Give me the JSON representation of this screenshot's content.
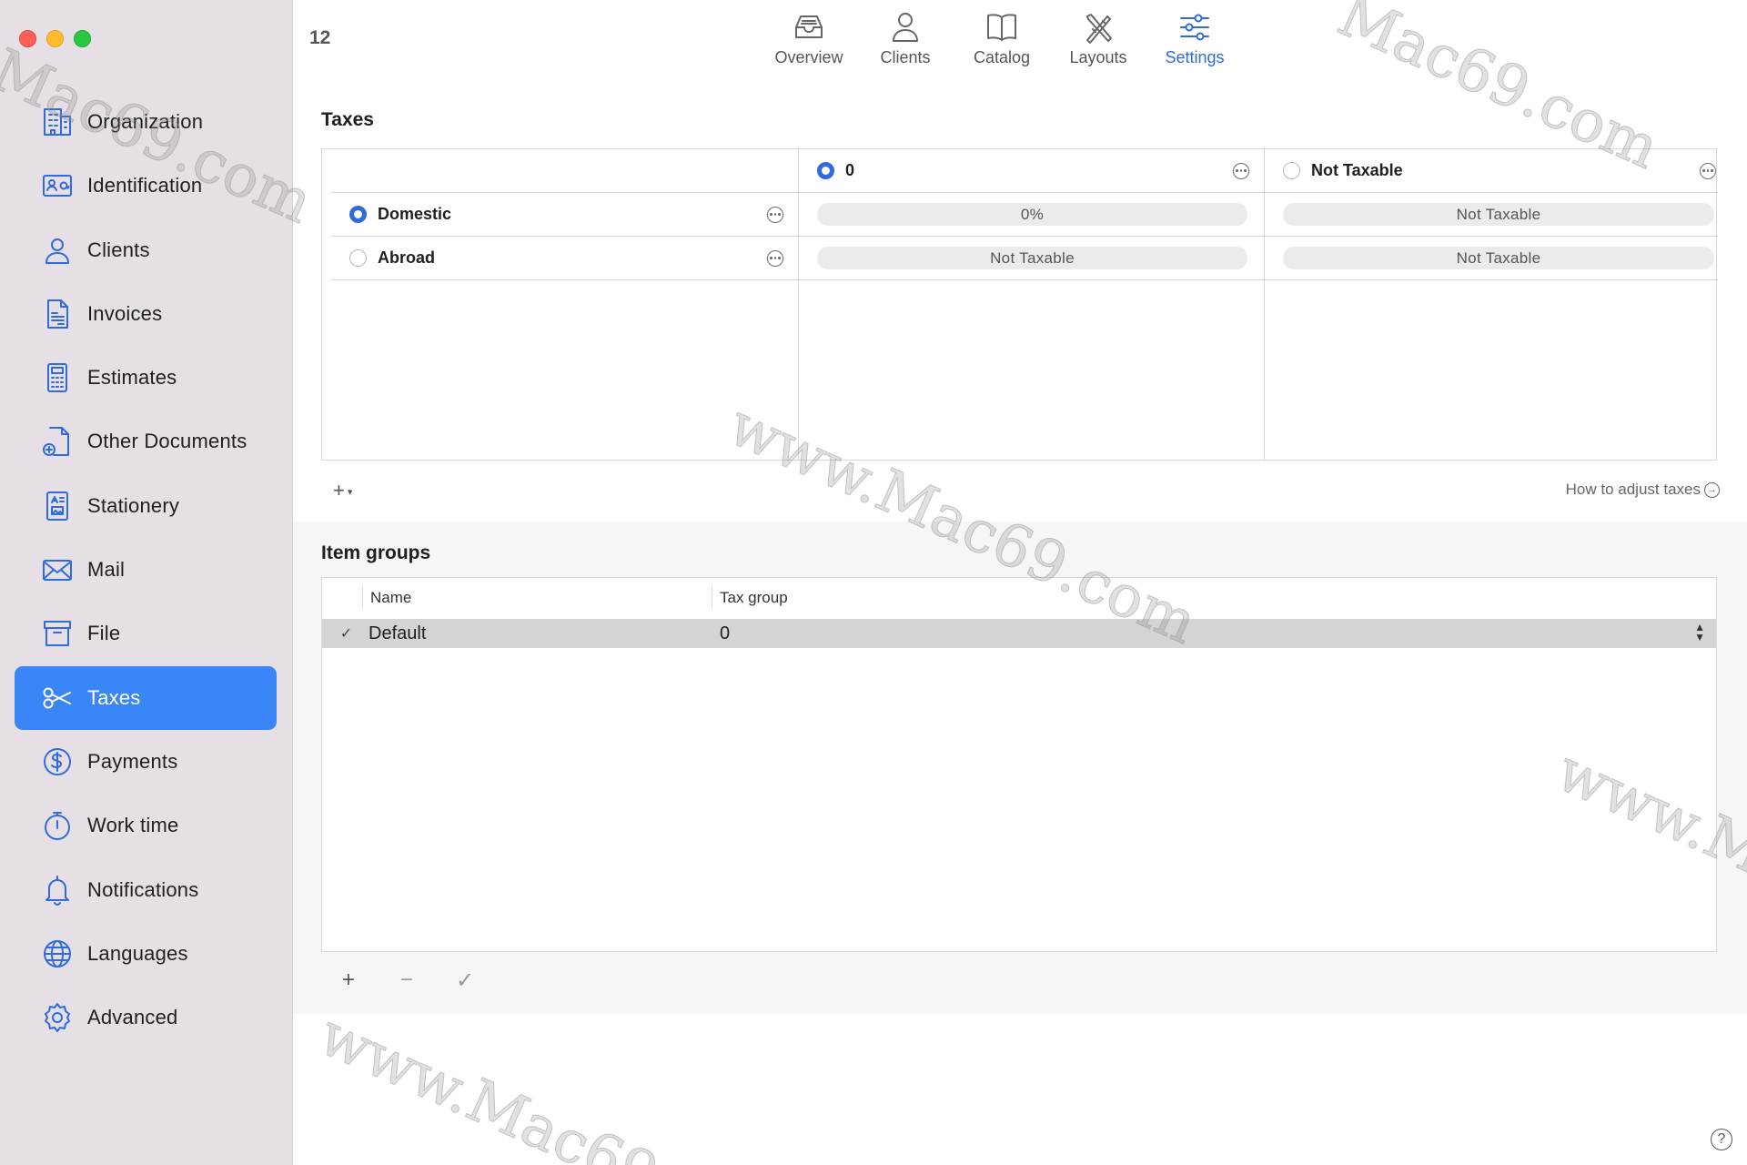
{
  "sidebar": {
    "items": [
      {
        "label": "Organization",
        "icon": "building-icon"
      },
      {
        "label": "Identification",
        "icon": "id-card-icon"
      },
      {
        "label": "Clients",
        "icon": "person-icon"
      },
      {
        "label": "Invoices",
        "icon": "invoice-doc-icon"
      },
      {
        "label": "Estimates",
        "icon": "calculator-icon"
      },
      {
        "label": "Other Documents",
        "icon": "doc-plus-icon"
      },
      {
        "label": "Stationery",
        "icon": "stationery-icon"
      },
      {
        "label": "Mail",
        "icon": "envelope-icon"
      },
      {
        "label": "File",
        "icon": "archive-box-icon"
      },
      {
        "label": "Taxes",
        "icon": "scissors-icon",
        "active": true
      },
      {
        "label": "Payments",
        "icon": "dollar-circle-icon"
      },
      {
        "label": "Work time",
        "icon": "stopwatch-icon"
      },
      {
        "label": "Notifications",
        "icon": "bell-icon"
      },
      {
        "label": "Languages",
        "icon": "globe-icon"
      },
      {
        "label": "Advanced",
        "icon": "gear-icon"
      }
    ]
  },
  "header": {
    "counter": "12",
    "tabs": [
      {
        "label": "Overview",
        "icon": "tray-icon"
      },
      {
        "label": "Clients",
        "icon": "person-icon"
      },
      {
        "label": "Catalog",
        "icon": "book-icon"
      },
      {
        "label": "Layouts",
        "icon": "layout-tools-icon"
      },
      {
        "label": "Settings",
        "icon": "sliders-icon",
        "active": true
      }
    ]
  },
  "taxes": {
    "title": "Taxes",
    "columns": [
      {
        "label": "0",
        "selected": true
      },
      {
        "label": "Not Taxable",
        "selected": false
      }
    ],
    "rows": [
      {
        "label": "Domestic",
        "selected": true,
        "values": [
          "0%",
          "Not Taxable"
        ]
      },
      {
        "label": "Abroad",
        "selected": false,
        "values": [
          "Not Taxable",
          "Not Taxable"
        ]
      }
    ],
    "add_label": "+",
    "help_link": "How to adjust taxes"
  },
  "item_groups": {
    "title": "Item groups",
    "headers": {
      "name": "Name",
      "tax_group": "Tax group"
    },
    "rows": [
      {
        "check": "✓",
        "name": "Default",
        "tax_group": "0"
      }
    ],
    "buttons": {
      "add": "+",
      "remove": "−",
      "confirm": "✓"
    }
  },
  "help_button": "?",
  "colors": {
    "accent": "#2f6bdc",
    "sidebar_bg": "#e6e0e6",
    "active_item": "#3b86f7"
  }
}
